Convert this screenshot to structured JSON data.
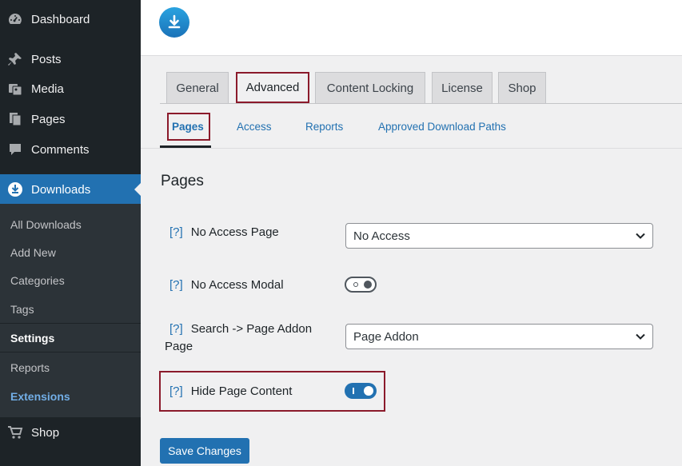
{
  "sidebar": {
    "items": [
      {
        "label": "Dashboard",
        "icon": "dashboard-icon"
      },
      {
        "label": "Posts",
        "icon": "pin-icon"
      },
      {
        "label": "Media",
        "icon": "media-icon"
      },
      {
        "label": "Pages",
        "icon": "pages-icon"
      },
      {
        "label": "Comments",
        "icon": "comment-icon"
      },
      {
        "label": "Downloads",
        "icon": "download-icon",
        "active": true
      },
      {
        "label": "Shop",
        "icon": "cart-icon"
      }
    ],
    "submenu": [
      "All Downloads",
      "Add New",
      "Categories",
      "Tags",
      "Settings",
      "Reports",
      "Extensions"
    ]
  },
  "tabs": [
    "General",
    "Advanced",
    "Content Locking",
    "License",
    "Shop"
  ],
  "active_tab": "Advanced",
  "subtabs": [
    "Pages",
    "Access",
    "Reports",
    "Approved Download Paths"
  ],
  "active_subtab": "Pages",
  "section_title": "Pages",
  "help_marker": "[?]",
  "fields": {
    "no_access_page": {
      "label": "No Access Page",
      "value": "No Access"
    },
    "no_access_modal": {
      "label": "No Access Modal",
      "enabled": false
    },
    "search_page_addon": {
      "label_line1": "Search -> Page Addon",
      "label_line2": "Page",
      "value": "Page Addon"
    },
    "hide_page_content": {
      "label": "Hide Page Content",
      "enabled": true
    }
  },
  "save_button": "Save Changes",
  "colors": {
    "sidebar_bg": "#1d2327",
    "submenu_bg": "#2c3338",
    "accent": "#2271b1",
    "highlight_border": "#8b1a2b"
  }
}
